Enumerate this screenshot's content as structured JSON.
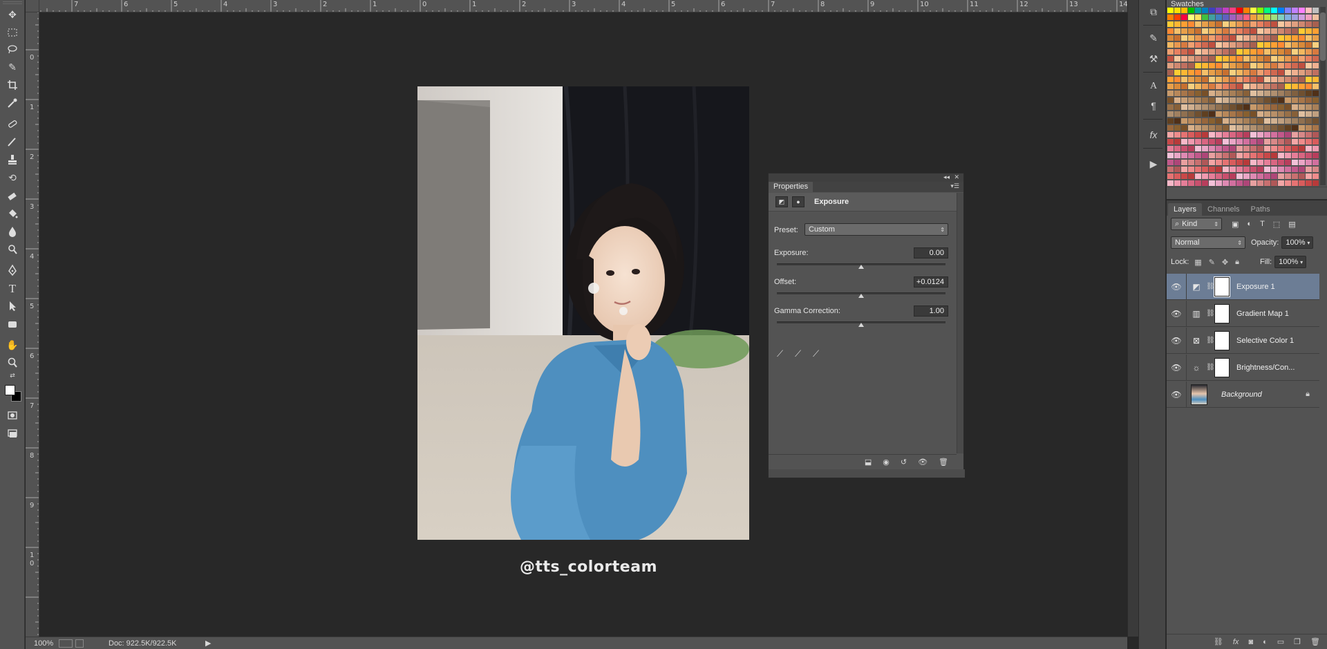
{
  "status": {
    "zoom": "100%",
    "doc": "Doc: 922.5K/922.5K"
  },
  "ruler": {
    "top_labels": [
      "7",
      "6",
      "5",
      "4",
      "3",
      "2",
      "1",
      "0",
      "1",
      "2",
      "3",
      "4",
      "5",
      "6",
      "7",
      "8",
      "9",
      "10",
      "11",
      "12",
      "13",
      "14"
    ],
    "left_labels": [
      "1",
      "0",
      "1",
      "2",
      "3",
      "4",
      "5",
      "6",
      "7",
      "8",
      "9",
      "1",
      "0"
    ]
  },
  "canvas": {
    "watermark": "@tts_colorteam"
  },
  "swatches": {
    "title": "Swatches"
  },
  "properties": {
    "tab": "Properties",
    "adjustment_title": "Exposure",
    "preset_label": "Preset:",
    "preset_value": "Custom",
    "exposure_label": "Exposure:",
    "exposure_value": "0.00",
    "offset_label": "Offset:",
    "offset_value": "+0.0124",
    "gamma_label": "Gamma Correction:",
    "gamma_value": "1.00",
    "exposure_level": 0.5,
    "offset_level": 0.5,
    "gamma_level": 0.5
  },
  "layers": {
    "tabs": [
      "Layers",
      "Channels",
      "Paths"
    ],
    "filter_kind": "Kind",
    "blend_mode": "Normal",
    "opacity_label": "Opacity:",
    "opacity_value": "100%",
    "lock_label": "Lock:",
    "fill_label": "Fill:",
    "fill_value": "100%",
    "items": [
      {
        "name": "Exposure 1",
        "icon": "exposure-icon",
        "active": true
      },
      {
        "name": "Gradient Map 1",
        "icon": "gradient-map-icon",
        "active": false
      },
      {
        "name": "Selective Color 1",
        "icon": "selective-color-icon",
        "active": false
      },
      {
        "name": "Brightness/Con...",
        "icon": "brightness-icon",
        "active": false
      },
      {
        "name": "Background",
        "icon": "background-thumbnail",
        "active": false
      }
    ]
  },
  "colors": {
    "ui_panel": "#535353",
    "canvas_bg": "#282828",
    "layer_selected": "#6c7d95"
  }
}
